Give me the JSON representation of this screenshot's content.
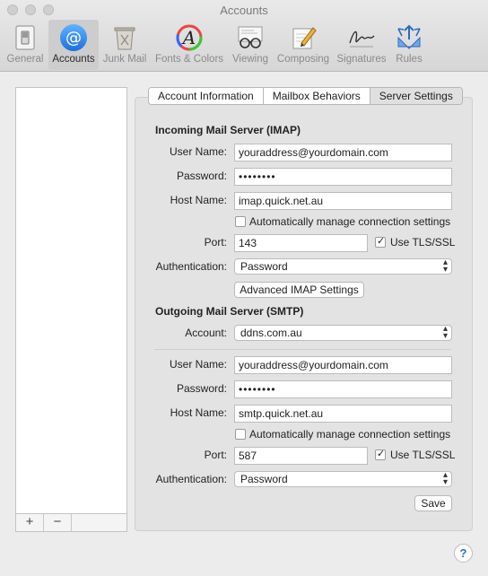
{
  "window": {
    "title": "Accounts"
  },
  "toolbar": {
    "items": [
      {
        "label": "General",
        "icon": "general-switch-icon"
      },
      {
        "label": "Accounts",
        "icon": "at-sign-icon",
        "selected": true
      },
      {
        "label": "Junk Mail",
        "icon": "trash-can-icon"
      },
      {
        "label": "Fonts & Colors",
        "icon": "fonts-colors-icon"
      },
      {
        "label": "Viewing",
        "icon": "glasses-icon"
      },
      {
        "label": "Composing",
        "icon": "compose-pencil-icon"
      },
      {
        "label": "Signatures",
        "icon": "signature-icon"
      },
      {
        "label": "Rules",
        "icon": "rules-arrows-icon"
      }
    ]
  },
  "list_bar": {
    "add": "+",
    "remove": "−"
  },
  "tabs": [
    {
      "label": "Account Information"
    },
    {
      "label": "Mailbox Behaviors"
    },
    {
      "label": "Server Settings",
      "selected": true
    }
  ],
  "incoming": {
    "title": "Incoming Mail Server (IMAP)",
    "user_label": "User Name:",
    "user_value": "youraddress@yourdomain.com",
    "password_label": "Password:",
    "password_value": "••••••••",
    "host_label": "Host Name:",
    "host_value": "imap.quick.net.au",
    "auto_label": "Automatically manage connection settings",
    "auto_checked": false,
    "port_label": "Port:",
    "port_value": "143",
    "tls_label": "Use TLS/SSL",
    "tls_checked": true,
    "auth_label": "Authentication:",
    "auth_value": "Password",
    "advanced_button": "Advanced IMAP Settings"
  },
  "outgoing": {
    "title": "Outgoing Mail Server (SMTP)",
    "account_label": "Account:",
    "account_value": "ddns.com.au",
    "user_label": "User Name:",
    "user_value": "youraddress@yourdomain.com",
    "password_label": "Password:",
    "password_value": "••••••••",
    "host_label": "Host Name:",
    "host_value": "smtp.quick.net.au",
    "auto_label": "Automatically manage connection settings",
    "auto_checked": false,
    "port_label": "Port:",
    "port_value": "587",
    "tls_label": "Use TLS/SSL",
    "tls_checked": true,
    "auth_label": "Authentication:",
    "auth_value": "Password"
  },
  "save_button": "Save",
  "help_button": "?"
}
